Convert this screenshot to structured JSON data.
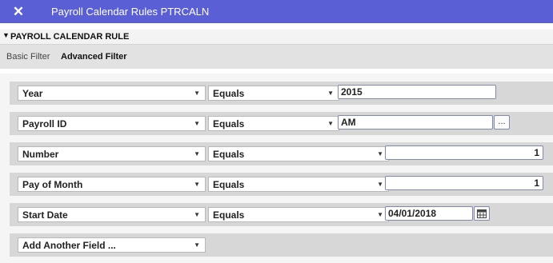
{
  "window": {
    "title": "Payroll Calendar Rules PTRCALN",
    "close_icon": "close-icon"
  },
  "section": {
    "title": "PAYROLL CALENDAR RULE",
    "toggle_icon": "collapse-triangle-icon"
  },
  "filter_tabs": {
    "basic": "Basic Filter",
    "advanced": "Advanced Filter"
  },
  "colors": {
    "titlebar": "#5b5fd6",
    "filter_bar": "#e2e2e2",
    "row_background": "#d7d7d7",
    "input_border": "#8088b3"
  },
  "rows": [
    {
      "field": "Year",
      "operator": "Equals",
      "value": "2015"
    },
    {
      "field": "Payroll ID",
      "operator": "Equals",
      "value": "AM",
      "lookup_label": "...",
      "lookup_icon": "ellipsis-lookup-icon"
    },
    {
      "field": "Number",
      "operator": "Equals",
      "value": "1"
    },
    {
      "field": "Pay of Month",
      "operator": "Equals",
      "value": "1"
    },
    {
      "field": "Start Date",
      "operator": "Equals",
      "value": "04/01/2018",
      "calendar_icon": "calendar-icon"
    }
  ],
  "add_field": {
    "label": "Add Another Field ..."
  },
  "dropdown_icon": "dropdown-arrow-icon"
}
